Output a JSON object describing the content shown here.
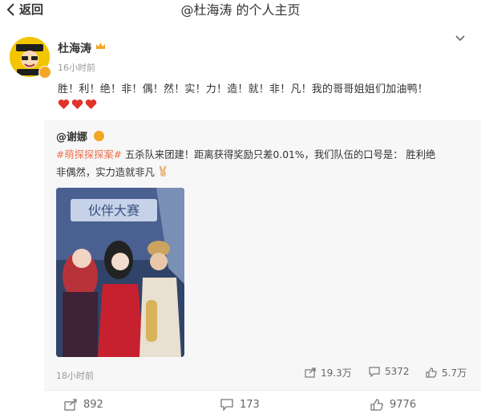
{
  "header": {
    "back_label": "返回",
    "title": "@杜海涛 的个人主页"
  },
  "post": {
    "author": "杜海涛",
    "time": "16小时前",
    "text": "胜！利！绝！非！偶！然！实！力！造！就！非！凡！我的哥哥姐姐们加油鸭！",
    "hearts": [
      "heart-icon",
      "heart-icon",
      "heart-icon"
    ]
  },
  "repost": {
    "author": "@谢娜",
    "hashtag": "#萌探探探案#",
    "line1_rest": " 五杀队来团建！距离获得奖励只差0.01%，我们队伍的口号是：  胜利绝",
    "line2": "非偶然，实力造就非凡",
    "photo_sign": "伙伴大赛",
    "time": "18小时前",
    "forward_count": "19.3万",
    "comment_count": "5372",
    "like_count": "5.7万"
  },
  "actions": {
    "forward_count": "892",
    "comment_count": "173",
    "like_count": "9776"
  },
  "colors": {
    "accent": "#eb7350",
    "heart": "#e0342b",
    "badge": "#f5a623",
    "repost_bg": "#f7f7f7"
  }
}
